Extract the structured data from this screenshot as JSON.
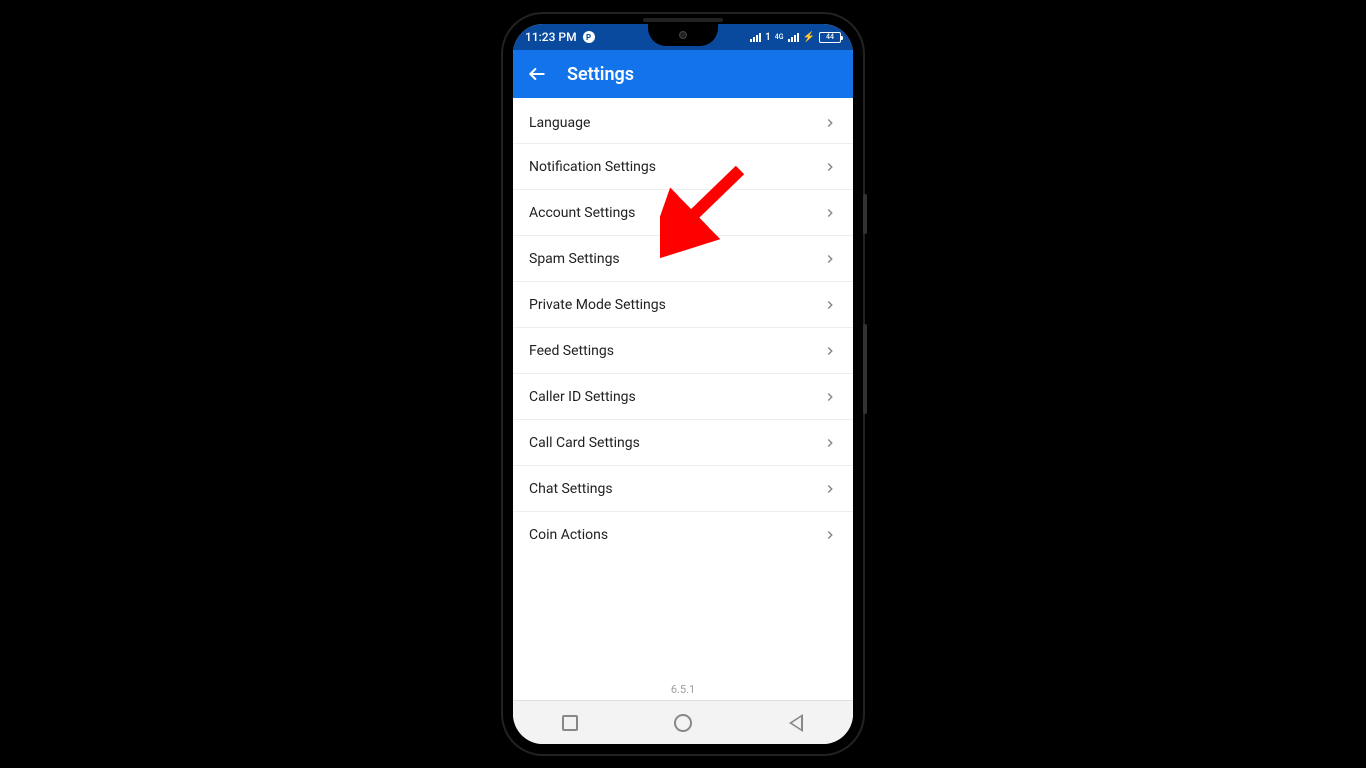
{
  "status_bar": {
    "time": "11:23 PM",
    "network_label": "4G",
    "battery_text": "44"
  },
  "app_bar": {
    "title": "Settings"
  },
  "settings": {
    "items": [
      {
        "label": "Language"
      },
      {
        "label": "Notification Settings"
      },
      {
        "label": "Account Settings"
      },
      {
        "label": "Spam Settings"
      },
      {
        "label": "Private Mode Settings"
      },
      {
        "label": "Feed Settings"
      },
      {
        "label": "Caller ID Settings"
      },
      {
        "label": "Call Card Settings"
      },
      {
        "label": "Chat Settings"
      },
      {
        "label": "Coin Actions"
      }
    ]
  },
  "footer": {
    "version": "6.5.1"
  },
  "annotation": {
    "arrow_color": "#ff0000"
  }
}
